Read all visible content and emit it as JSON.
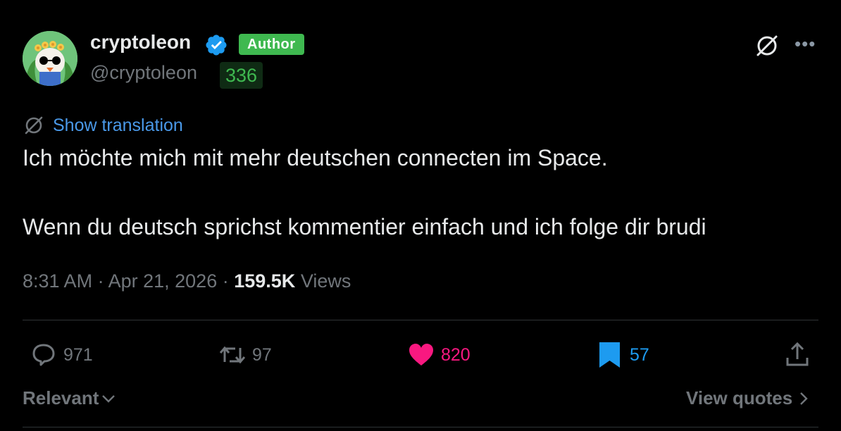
{
  "author": {
    "display_name": "cryptoleon",
    "handle": "@cryptoleon",
    "badge": "Author",
    "score": "336",
    "verified_color": "#1d9bf0"
  },
  "translation": {
    "label": "Show translation"
  },
  "post": {
    "line1": "Ich möchte mich mit mehr deutschen connecten im Space.",
    "line2": "Wenn du deutsch sprichst kommentier einfach und ich folge dir brudi"
  },
  "meta": {
    "time": "8:31 AM",
    "date": "Apr 21, 2026",
    "views_count": "159.5K",
    "views_label": "Views"
  },
  "actions": {
    "replies": "971",
    "reposts": "97",
    "likes": "820",
    "bookmarks": "57",
    "like_color": "#f91880",
    "bookmark_color": "#1d9bf0"
  },
  "footer": {
    "sort_label": "Relevant",
    "quotes_label": "View quotes"
  },
  "icons": [
    "translate-icon",
    "more-icon",
    "reply-icon",
    "repost-icon",
    "like-icon",
    "bookmark-icon",
    "share-icon",
    "chevron-down-icon",
    "chevron-right-icon"
  ]
}
